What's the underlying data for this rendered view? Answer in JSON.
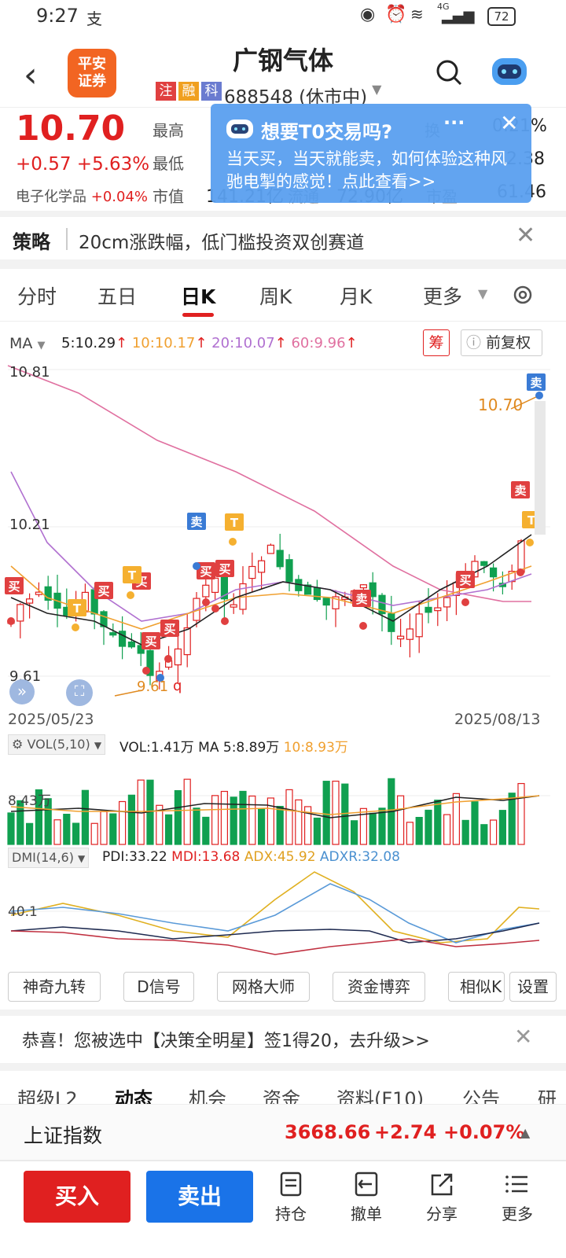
{
  "status_bar": {
    "time": "9:27",
    "alipay_glyph": "支",
    "battery": "72",
    "network": "4G"
  },
  "header": {
    "back_icon": "back-arrow-icon",
    "logo_line1": "平安",
    "logo_line2": "证券",
    "stock_name": "广钢气体",
    "tags": [
      "注",
      "融",
      "科"
    ],
    "tag_colors": [
      "#e04040",
      "#f0a020",
      "#6a7bd0"
    ],
    "code_status": "688548 (休市中)",
    "search_icon": "search-icon",
    "robot_icon": "robot-assistant-icon"
  },
  "quote": {
    "price": "10.70",
    "change": "+0.57",
    "change_pct": "+5.63%",
    "sector": "电子化学品",
    "sector_pct": "+0.04%",
    "high_label": "最高",
    "low_label": "最低",
    "mktcap_label": "市值",
    "mktcap_partial": "141.21亿",
    "float_label": "流通",
    "float_partial": "72.90亿",
    "turn_label": "换",
    "turn_partial": "0.21%",
    "right2_partial": "2.38",
    "right3_partial": "61.46",
    "right3_label": "市盈"
  },
  "popup": {
    "title": "想要T0交易吗?",
    "body": "当天买，当天就能卖，如何体验这种风驰电掣的感觉！点此查看>>"
  },
  "strategy": {
    "label": "策略",
    "text": "20cm涨跌幅，低门槛投资双创赛道"
  },
  "tabs": [
    "分时",
    "五日",
    "日K",
    "周K",
    "月K",
    "更多"
  ],
  "active_tab": 2,
  "ma_bar": {
    "label": "MA",
    "ma5": "5:10.29",
    "ma10": "10:10.17",
    "ma20": "20:10.07",
    "ma60": "60:9.96",
    "chip_button": "筹",
    "adjust_button": "前复权",
    "colors": {
      "ma5": "#222222",
      "ma10": "#f0a030",
      "ma20": "#b070d0",
      "ma60": "#e070a0"
    }
  },
  "kline": {
    "y_max_label": "10.81",
    "y_mid_label": "10.21",
    "y_min_label": "9.61",
    "date_start": "2025/05/23",
    "date_end": "2025/08/13",
    "last_price_label": "10.70",
    "low_marker_label": "9.61",
    "sell_marker": "卖",
    "buy_marker": "买",
    "t_marker": "T",
    "q_marker": "q"
  },
  "volume": {
    "indicator": "VOL(5,10)",
    "vol": "VOL:1.41万",
    "ma5": "MA 5:8.89万",
    "ma10": "10:8.93万",
    "y_label": "8.43万"
  },
  "dmi": {
    "indicator": "DMI(14,6)",
    "pdi": "PDI:33.22",
    "mdi": "MDI:13.68",
    "adx": "ADX:45.92",
    "adxr": "ADXR:32.08",
    "y_label": "40.1"
  },
  "func_buttons": [
    "神奇九转",
    "D信号",
    "网格大师",
    "资金博弈",
    "相似K",
    "设置"
  ],
  "promo": {
    "text": "恭喜！您被选中【决策全明星】签1得20，去升级>>"
  },
  "bottom_tabs": [
    "超级L2",
    "动态",
    "机会",
    "资金",
    "资料(F10)",
    "公告",
    "研"
  ],
  "bottom_active": 1,
  "index_bar": {
    "name": "上证指数",
    "value": "3668.66",
    "change": "+2.74",
    "pct": "+0.07%"
  },
  "actions": {
    "buy": "买入",
    "sell": "卖出",
    "nav": [
      {
        "label": "持仓",
        "icon": "holdings-icon"
      },
      {
        "label": "撤单",
        "icon": "cancel-order-icon"
      },
      {
        "label": "分享",
        "icon": "share-icon"
      },
      {
        "label": "更多",
        "icon": "more-icon"
      }
    ]
  }
}
